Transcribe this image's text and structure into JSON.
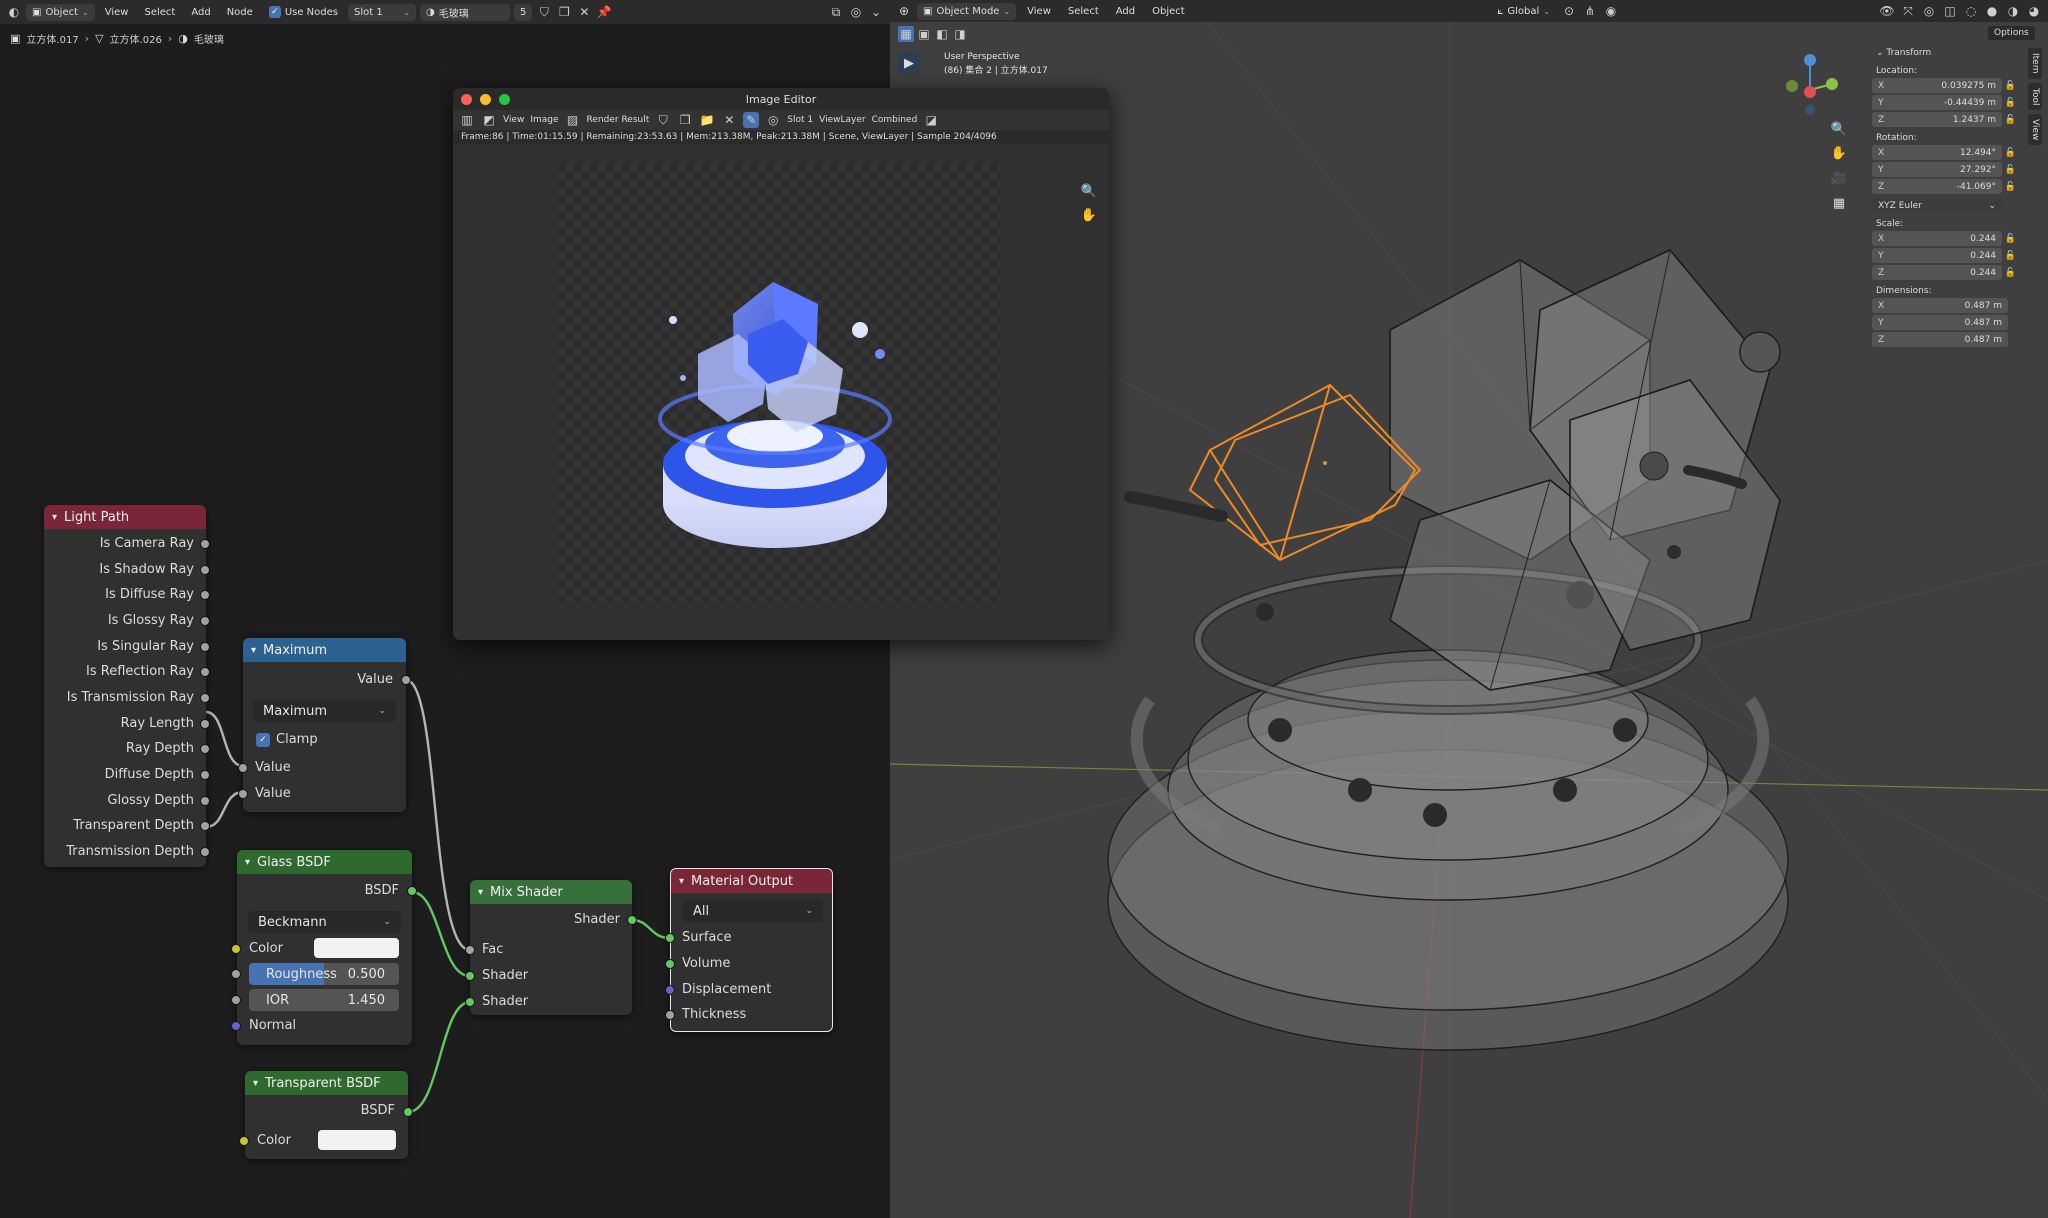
{
  "node_editor": {
    "header": {
      "mode": "Object",
      "menus": [
        "View",
        "Select",
        "Add",
        "Node"
      ],
      "use_nodes_label": "Use Nodes",
      "slot": "Slot 1",
      "material": "毛玻璃",
      "users": "5"
    },
    "breadcrumb": [
      "立方体.017",
      "立方体.026",
      "毛玻璃"
    ],
    "nodes": {
      "light_path": {
        "title": "Light Path",
        "outputs": [
          "Is Camera Ray",
          "Is Shadow Ray",
          "Is Diffuse Ray",
          "Is Glossy Ray",
          "Is Singular Ray",
          "Is Reflection Ray",
          "Is Transmission Ray",
          "Ray Length",
          "Ray Depth",
          "Diffuse Depth",
          "Glossy Depth",
          "Transparent Depth",
          "Transmission Depth"
        ]
      },
      "maximum": {
        "title": "Maximum",
        "output": "Value",
        "operation": "Maximum",
        "clamp_label": "Clamp",
        "inputs": [
          "Value",
          "Value"
        ]
      },
      "glass": {
        "title": "Glass BSDF",
        "output": "BSDF",
        "distribution": "Beckmann",
        "color_label": "Color",
        "roughness_label": "Roughness",
        "roughness_value": "0.500",
        "ior_label": "IOR",
        "ior_value": "1.450",
        "normal_label": "Normal"
      },
      "transparent": {
        "title": "Transparent BSDF",
        "output": "BSDF",
        "color_label": "Color"
      },
      "mix": {
        "title": "Mix Shader",
        "output": "Shader",
        "inputs": [
          "Fac",
          "Shader",
          "Shader"
        ]
      },
      "material_output": {
        "title": "Material Output",
        "target": "All",
        "inputs": [
          "Surface",
          "Volume",
          "Displacement",
          "Thickness"
        ]
      }
    }
  },
  "image_editor": {
    "title": "Image Editor",
    "menus": [
      "View",
      "Image"
    ],
    "image_name": "Render Result",
    "slot": "Slot 1",
    "view_layer": "ViewLayer",
    "pass": "Combined",
    "status": "Frame:86 | Time:01:15.59 | Remaining:23:53.63 | Mem:213.38M, Peak:213.38M | Scene, ViewLayer | Sample 204/4096"
  },
  "viewport": {
    "header": {
      "mode": "Object Mode",
      "menus": [
        "View",
        "Select",
        "Add",
        "Object"
      ],
      "orientation": "Global",
      "options": "Options"
    },
    "info": {
      "perspective": "User Perspective",
      "collection": "(86) 集合 2 | 立方体.017"
    },
    "transform": {
      "title": "Transform",
      "location_label": "Location:",
      "location": [
        {
          "axis": "X",
          "value": "0.039275 m"
        },
        {
          "axis": "Y",
          "value": "-0.44439 m"
        },
        {
          "axis": "Z",
          "value": "1.2437 m"
        }
      ],
      "rotation_label": "Rotation:",
      "rotation": [
        {
          "axis": "X",
          "value": "12.494°"
        },
        {
          "axis": "Y",
          "value": "27.292°"
        },
        {
          "axis": "Z",
          "value": "-41.069°"
        }
      ],
      "rotation_mode": "XYZ Euler",
      "scale_label": "Scale:",
      "scale": [
        {
          "axis": "X",
          "value": "0.244"
        },
        {
          "axis": "Y",
          "value": "0.244"
        },
        {
          "axis": "Z",
          "value": "0.244"
        }
      ],
      "dimensions_label": "Dimensions:",
      "dimensions": [
        {
          "axis": "X",
          "value": "0.487 m"
        },
        {
          "axis": "Y",
          "value": "0.487 m"
        },
        {
          "axis": "Z",
          "value": "0.487 m"
        }
      ]
    },
    "sidebar_tabs": [
      "Item",
      "Tool",
      "View"
    ]
  }
}
